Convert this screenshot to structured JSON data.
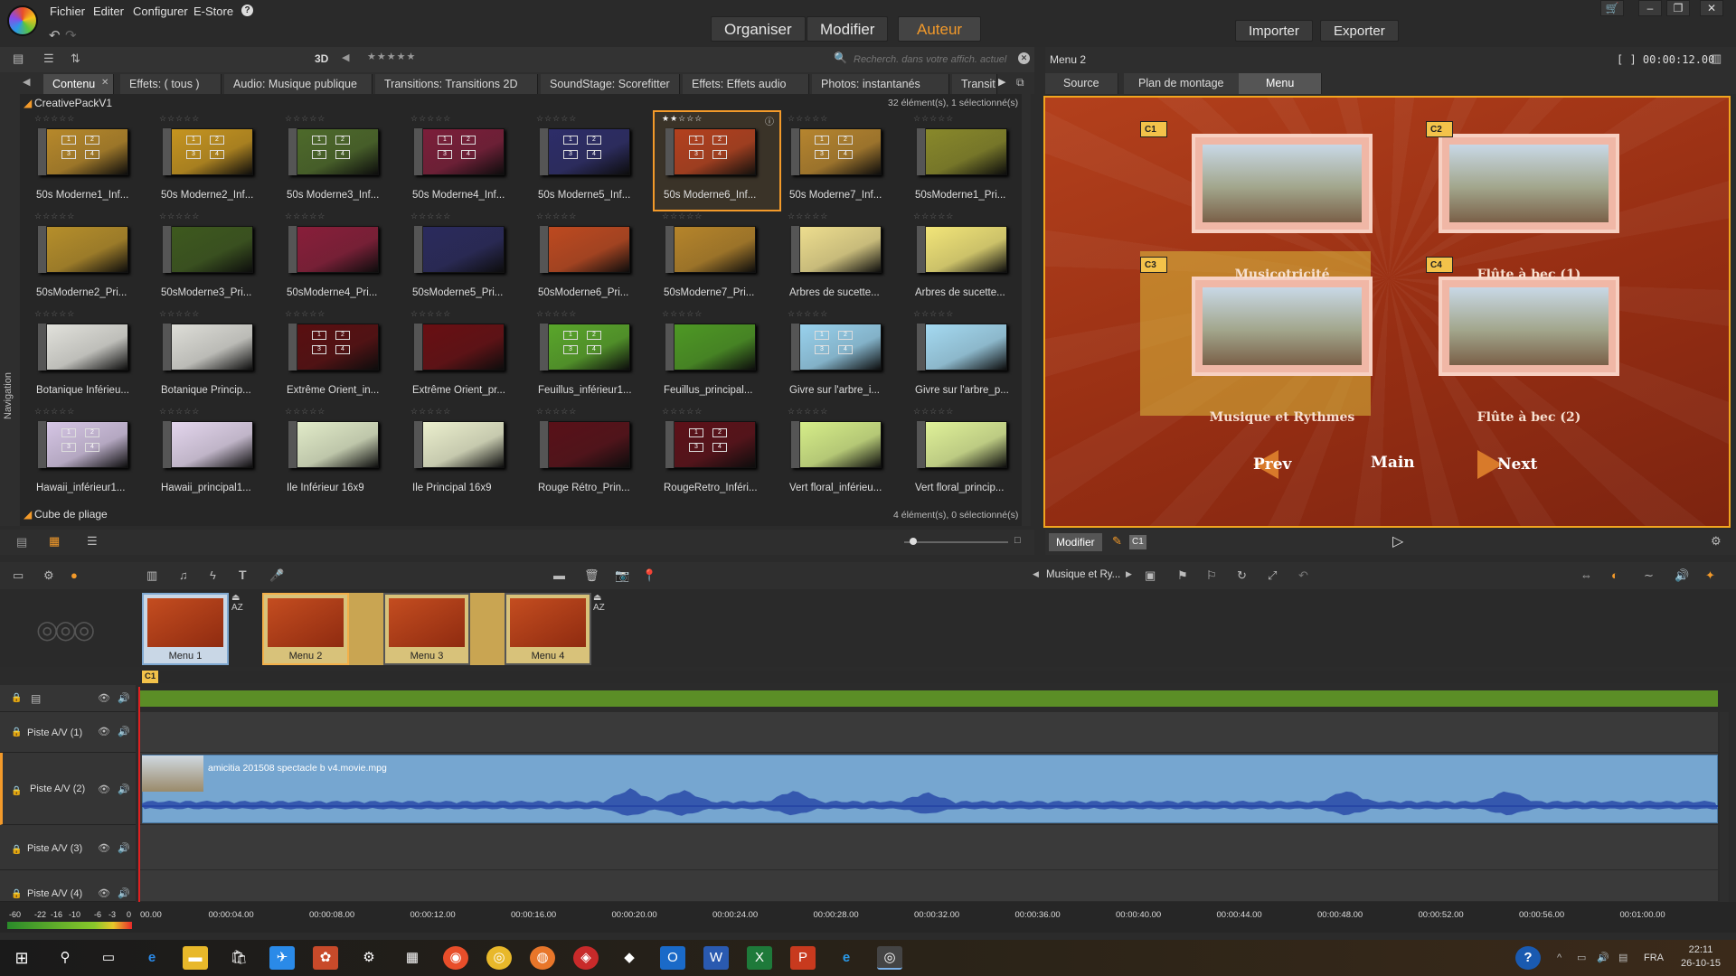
{
  "menu": {
    "file": "Fichier",
    "edit": "Editer",
    "configure": "Configurer",
    "estore": "E-Store",
    "help": "?"
  },
  "modes": {
    "organize": "Organiser",
    "modify": "Modifier",
    "author": "Auteur"
  },
  "actions": {
    "import": "Importer",
    "export": "Exporter"
  },
  "library": {
    "mode3d": "3D",
    "search_placeholder": "Recherch. dans votre affich. actuel",
    "tabs": [
      "Contenu",
      "Effets: ( tous )",
      "Audio: Musique publique",
      "Transitions: Transitions 2D",
      "SoundStage: Scorefitter",
      "Effets: Effets audio",
      "Photos: instantanés",
      "Transit"
    ],
    "group1": "CreativePackV1",
    "group1_count": "32 élément(s), 1 sélectionné(s)",
    "group2": "Cube de pliage",
    "group2_count": "4 élément(s), 0 sélectionné(s)",
    "nav_label": "Navigation",
    "items": [
      {
        "label": "50s Moderne1_Inf...",
        "color": "#b98a2a",
        "grid": true
      },
      {
        "label": "50s Moderne2_Inf...",
        "color": "#c8961f",
        "grid": true
      },
      {
        "label": "50s Moderne3_Inf...",
        "color": "#4e6b2a",
        "grid": true
      },
      {
        "label": "50s Moderne4_Inf...",
        "color": "#7d1e3a",
        "grid": true
      },
      {
        "label": "50s Moderne5_Inf...",
        "color": "#2d2d6a",
        "grid": true
      },
      {
        "label": "50s Moderne6_Inf...",
        "color": "#b5401e",
        "grid": true,
        "selected": true
      },
      {
        "label": "50s Moderne7_Inf...",
        "color": "#b8862e",
        "grid": true
      },
      {
        "label": "50sModerne1_Pri...",
        "color": "#8a8a2a",
        "grid": false
      },
      {
        "label": "50sModerne2_Pri...",
        "color": "#b8902a",
        "grid": false
      },
      {
        "label": "50sModerne3_Pri...",
        "color": "#3e5a1e",
        "grid": false
      },
      {
        "label": "50sModerne4_Pri...",
        "color": "#8a1e3a",
        "grid": false
      },
      {
        "label": "50sModerne5_Pri...",
        "color": "#2a2a5e",
        "grid": false
      },
      {
        "label": "50sModerne6_Pri...",
        "color": "#c04a20",
        "grid": false
      },
      {
        "label": "50sModerne7_Pri...",
        "color": "#b8862a",
        "grid": false
      },
      {
        "label": "Arbres de sucette...",
        "color": "#f0e090",
        "grid": false
      },
      {
        "label": "Arbres de sucette...",
        "color": "#f5e87a",
        "grid": false
      },
      {
        "label": "Botanique Inférieu...",
        "color": "#e4e4de",
        "grid": false
      },
      {
        "label": "Botanique Princip...",
        "color": "#e0e0da",
        "grid": false
      },
      {
        "label": "Extrême Orient_in...",
        "color": "#5a0e10",
        "grid": true
      },
      {
        "label": "Extrême Orient_pr...",
        "color": "#6a0e12",
        "grid": false
      },
      {
        "label": "Feuillus_inférieur1...",
        "color": "#5aa82a",
        "grid": true
      },
      {
        "label": "Feuillus_principal...",
        "color": "#4e9a24",
        "grid": false
      },
      {
        "label": "Givre sur l'arbre_i...",
        "color": "#9ad4f0",
        "grid": true
      },
      {
        "label": "Givre sur l'arbre_p...",
        "color": "#a6dcf4",
        "grid": false
      },
      {
        "label": "Hawaii_inférieur1...",
        "color": "#d8c8e8",
        "grid": true
      },
      {
        "label": "Hawaii_principal1...",
        "color": "#e6d8f0",
        "grid": false
      },
      {
        "label": "Ile Inférieur 16x9",
        "color": "#e4eecb",
        "grid": false
      },
      {
        "label": "Ile Principal 16x9",
        "color": "#eef2d0",
        "grid": false
      },
      {
        "label": "Rouge Rétro_Prin...",
        "color": "#5a1018",
        "grid": false
      },
      {
        "label": "RougeRetro_Inféri...",
        "color": "#5e1018",
        "grid": true
      },
      {
        "label": "Vert floral_inférieu...",
        "color": "#d8f08a",
        "grid": false
      },
      {
        "label": "Vert floral_princip...",
        "color": "#e2f49a",
        "grid": false
      }
    ]
  },
  "preview": {
    "title": "Menu 2",
    "timecode": "[ ] 00:00:12.00",
    "tabs": [
      "Source",
      "Plan de montage",
      "Menu"
    ],
    "chapters": [
      {
        "badge": "C1",
        "caption": "Musicotricité"
      },
      {
        "badge": "C2",
        "caption": "Flûte à bec (1)"
      },
      {
        "badge": "C3",
        "caption": "Musique et Rythmes"
      },
      {
        "badge": "C4",
        "caption": "Flûte à bec (2)"
      }
    ],
    "nav": {
      "prev": "Prev",
      "main": "Main",
      "next": "Next"
    },
    "modify_btn": "Modifier",
    "chapter_tag": "C1"
  },
  "timeline": {
    "track_selector": "Musique et Ry...",
    "menus": [
      "Menu 1",
      "Menu 2",
      "Menu 3",
      "Menu 4"
    ],
    "chapter_marker": "C1",
    "tracks": [
      "Piste A/V (1)",
      "Piste A/V (2)",
      "Piste A/V (3)",
      "Piste A/V (4)"
    ],
    "clip_name": "amicitia 201508 spectacle b v4.movie.mpg",
    "meter_labels": [
      "-60",
      "-22",
      "-16",
      "-10",
      "-6",
      "-3",
      "0"
    ],
    "times": [
      "00.00",
      "00:00:04.00",
      "00:00:08.00",
      "00:00:12.00",
      "00:00:16.00",
      "00:00:20.00",
      "00:00:24.00",
      "00:00:28.00",
      "00:00:32.00",
      "00:00:36.00",
      "00:00:40.00",
      "00:00:44.00",
      "00:00:48.00",
      "00:00:52.00",
      "00:00:56.00",
      "00:01:00.00"
    ]
  },
  "taskbar": {
    "lang": "FRA",
    "time": "22:11",
    "date": "26-10-15"
  }
}
